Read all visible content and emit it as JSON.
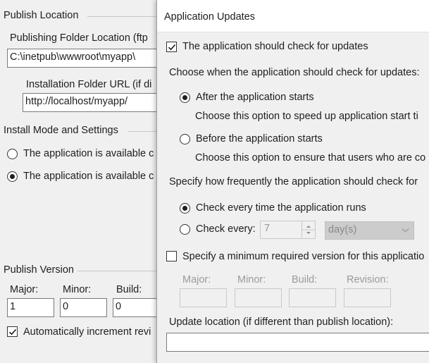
{
  "background_panel": {
    "publish_location": {
      "title": "Publish Location",
      "folder_label": "Publishing Folder Location (ftp",
      "folder_value": "C:\\inetpub\\wwwroot\\myapp\\",
      "install_url_label": "Installation Folder URL (if di",
      "install_url_value": "http://localhost/myapp/"
    },
    "install_mode": {
      "title": "Install Mode and Settings",
      "option_1": "The application is available c",
      "option_2": "The application is available c",
      "selected": 2
    },
    "publish_version": {
      "title": "Publish Version",
      "major_label": "Major:",
      "minor_label": "Minor:",
      "build_label": "Build:",
      "major_value": "1",
      "minor_value": "0",
      "build_value": "0",
      "auto_increment_label": "Automatically increment revi",
      "auto_increment_checked": true
    }
  },
  "dialog": {
    "title": "Application Updates",
    "check_updates_label": "The application should check for updates",
    "check_updates_checked": true,
    "when_prompt": "Choose when the application should check for updates:",
    "after_label": "After the application starts",
    "after_desc": "Choose this option to speed up application start ti",
    "before_label": "Before the application starts",
    "before_desc": "Choose this option to ensure that users who are co",
    "when_selected": "after",
    "frequency_prompt": "Specify how frequently the application should check for",
    "every_run_label": "Check every time the application runs",
    "check_every_label": "Check every:",
    "frequency_selected": "every_run",
    "interval_value": "7",
    "interval_unit": "day(s)",
    "min_version_label": "Specify a minimum required version for this applicatio",
    "min_version_checked": false,
    "major_label": "Major:",
    "minor_label": "Minor:",
    "build_label": "Build:",
    "revision_label": "Revision:",
    "update_location_label": "Update location (if different than publish location):",
    "update_location_value": ""
  }
}
